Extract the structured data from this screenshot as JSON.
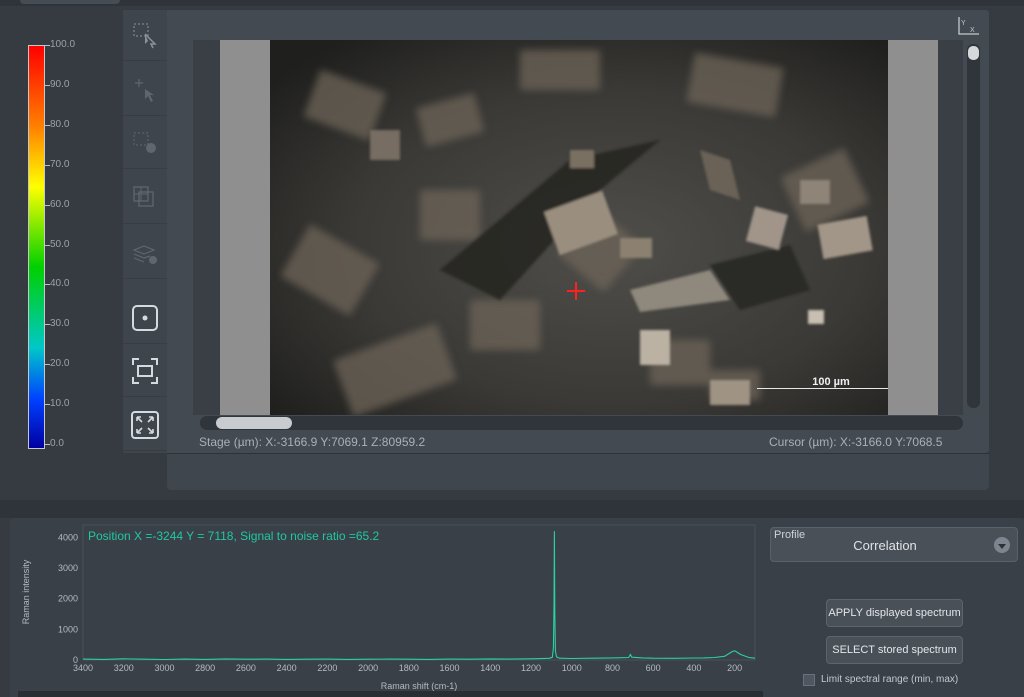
{
  "colorbar": {
    "labels": [
      "100.0",
      "90.0",
      "80.0",
      "70.0",
      "60.0",
      "50.0",
      "40.0",
      "30.0",
      "20.0",
      "10.0",
      "0.0"
    ],
    "colors": [
      "#ff0000",
      "#ff8000",
      "#ffff00",
      "#00d000",
      "#00c8c8",
      "#0040ff",
      "#0000a0"
    ]
  },
  "toolbar": {
    "tools": [
      {
        "name": "select-area-tool-icon"
      },
      {
        "name": "select-point-tool-icon"
      },
      {
        "name": "area-time-tool-icon"
      },
      {
        "name": "layers-tool-icon"
      },
      {
        "name": "layer-stack-tool-icon"
      },
      {
        "name": "single-point-mode-icon"
      },
      {
        "name": "fit-frame-icon"
      },
      {
        "name": "fullscreen-icon"
      }
    ]
  },
  "viewer": {
    "scale_bar_label": "100 µm",
    "stage_readout": "Stage (µm): X:-3166.9 Y:7069.1 Z:80959.2",
    "cursor_readout": "Cursor (µm): X:-3166.0 Y:7068.5",
    "marker_color": "#ff2020"
  },
  "spectrum": {
    "annotation": "Position X =-3244 Y = 7118, Signal to noise ratio =65.2",
    "annotation_color": "#20c8a0",
    "line_color": "#2ad0a6"
  },
  "chart_data": {
    "type": "line",
    "title": "",
    "xlabel": "Raman shift (cm-1)",
    "ylabel": "Raman intensity",
    "xlim": [
      3400,
      100
    ],
    "ylim": [
      0,
      4400
    ],
    "x_ticks": [
      3400,
      3200,
      3000,
      2800,
      2600,
      2400,
      2200,
      2000,
      1800,
      1600,
      1400,
      1200,
      1000,
      800,
      600,
      400,
      200
    ],
    "y_ticks": [
      0,
      1000,
      2000,
      3000,
      4000
    ],
    "grid": false,
    "series": [
      {
        "x": [
          3400,
          3300,
          3200,
          3100,
          3000,
          2900,
          2800,
          2700,
          2600,
          2500,
          2400,
          2300,
          2200,
          2100,
          2000,
          1900,
          1800,
          1700,
          1600,
          1500,
          1400,
          1300,
          1200,
          1150,
          1110,
          1095,
          1090,
          1087,
          1085,
          1083,
          1080,
          1075,
          1060,
          1000,
          900,
          800,
          720,
          712,
          705,
          650,
          600,
          500,
          400,
          350,
          300,
          250,
          230,
          210,
          200,
          190,
          170,
          150,
          130,
          100
        ],
        "y": [
          30,
          20,
          40,
          25,
          15,
          30,
          20,
          35,
          25,
          30,
          20,
          25,
          30,
          20,
          25,
          30,
          25,
          20,
          30,
          25,
          35,
          30,
          40,
          45,
          55,
          90,
          400,
          1800,
          4200,
          1600,
          300,
          100,
          60,
          50,
          60,
          70,
          80,
          180,
          90,
          70,
          60,
          55,
          65,
          70,
          80,
          120,
          200,
          280,
          300,
          260,
          180,
          130,
          80,
          60
        ]
      }
    ]
  },
  "profile": {
    "label": "Profile",
    "value": "Correlation"
  },
  "buttons": {
    "apply": "APPLY displayed spectrum",
    "select": "SELECT stored spectrum"
  },
  "limit_range": {
    "label": "Limit spectral range (min, max)",
    "checked": false
  }
}
